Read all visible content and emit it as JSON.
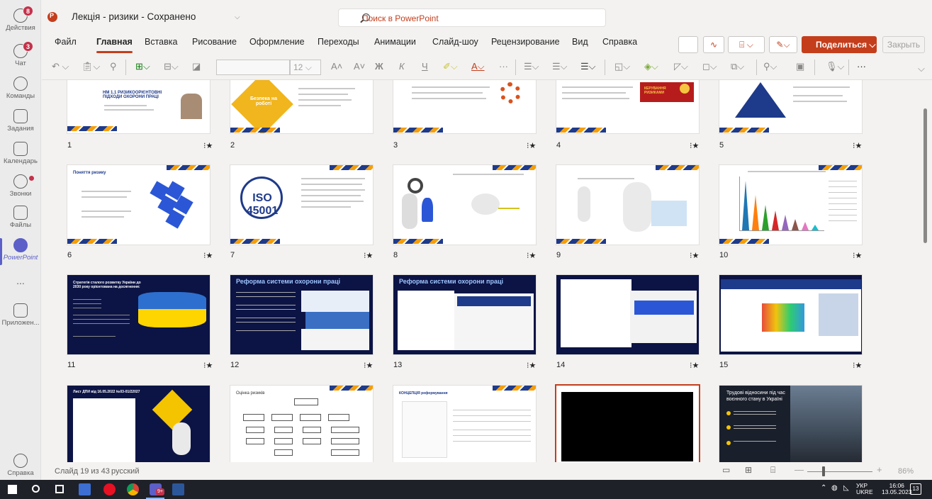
{
  "rail": {
    "items": [
      {
        "label": "Действия",
        "badge": "8"
      },
      {
        "label": "Чат",
        "badge": "3"
      },
      {
        "label": "Команды"
      },
      {
        "label": "Задания"
      },
      {
        "label": "Календарь"
      },
      {
        "label": "Звонки"
      },
      {
        "label": "Файлы"
      },
      {
        "label": "PowerPoint"
      },
      {
        "label": "..."
      },
      {
        "label": "Приложен..."
      }
    ],
    "help_label": "Справка"
  },
  "titlebar": {
    "doc_title": "Лекція - ризики  -  Сохранено",
    "search_placeholder": "Поиск в PowerPoint"
  },
  "ribbon": {
    "tabs": [
      "Файл",
      "Главная",
      "Вставка",
      "Рисование",
      "Оформление",
      "Переходы",
      "Анимации",
      "Слайд-шоу",
      "Рецензирование",
      "Вид",
      "Справка"
    ],
    "active_tab": "Главная",
    "share_label": "Поделиться",
    "close_label": "Закрыть"
  },
  "toolbar": {
    "font_size": "12",
    "bold": "Ж",
    "italic": "К",
    "underline": "Ч",
    "more": "···"
  },
  "slides": [
    {
      "n": "1",
      "title": "НМ 1.1 РИЗИКООРІЄНТОВНІ ПІДХОДИ ОХОРОНИ ПРАЦІ"
    },
    {
      "n": "2",
      "title": "Безпека на роботі"
    },
    {
      "n": "3",
      "title": ""
    },
    {
      "n": "4",
      "title": "КЕРУВАННЯ РИЗИКАМИ"
    },
    {
      "n": "5",
      "title": ""
    },
    {
      "n": "6",
      "title": "Поняття ризику"
    },
    {
      "n": "7",
      "title": "ISO 45001"
    },
    {
      "n": "8",
      "title": ""
    },
    {
      "n": "9",
      "title": ""
    },
    {
      "n": "10",
      "title": ""
    },
    {
      "n": "11",
      "title": "Стратегія сталого розвитку України до 2030 року орієнтована на досягнення:"
    },
    {
      "n": "12",
      "title": "Реформа системи охорони праці"
    },
    {
      "n": "13",
      "title": "Реформа системи охорони праці"
    },
    {
      "n": "14",
      "title": ""
    },
    {
      "n": "15",
      "title": ""
    },
    {
      "n": "16",
      "title": "Лист ДПИ від 16.05.2022 №03-01/22027"
    },
    {
      "n": "17",
      "title": "Оцінка ризиків"
    },
    {
      "n": "18",
      "title": "КОНЦЕПЦІЯ реформування"
    },
    {
      "n": "19",
      "title": ""
    },
    {
      "n": "20",
      "title": "Трудові відносини під час воєнного стану в Україні"
    }
  ],
  "statusbar": {
    "slide_info": "Слайд 19 из 43",
    "language": "русский",
    "zoom": "86%"
  },
  "taskbar": {
    "lang": "УКР",
    "lang2": "UKRE",
    "time": "16:06",
    "date": "13.05.2023",
    "notif": "13",
    "teams_badge": "9+"
  },
  "colors": {
    "accent": "#c43e1c",
    "teams": "#5b5fc7",
    "navy_slide": "#0c1445"
  }
}
